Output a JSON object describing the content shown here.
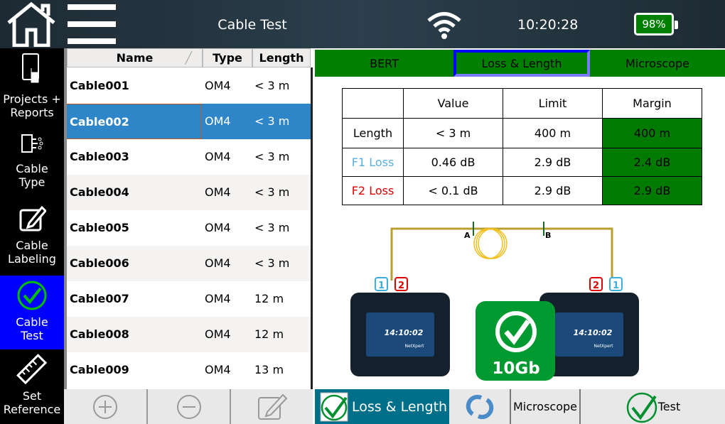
{
  "header": {
    "title": "Cable Test",
    "time": "10:20:28",
    "battery": "98%",
    "icons": [
      "home-icon",
      "menu-icon",
      "wifi-icon",
      "battery-icon"
    ]
  },
  "sidebar": {
    "items": [
      {
        "label1": "Projects +",
        "label2": "Reports",
        "icon": "tablet-touch-icon"
      },
      {
        "label1": "Cable",
        "label2": "Type",
        "icon": "fiber-connector-icon"
      },
      {
        "label1": "Cable",
        "label2": "Labeling",
        "icon": "edit-icon"
      },
      {
        "label1": "Cable",
        "label2": "Test",
        "icon": "check-circle-icon",
        "active": true
      },
      {
        "label1": "Set",
        "label2": "Reference",
        "icon": "ruler-icon"
      }
    ]
  },
  "cable_list": {
    "columns": [
      "Name",
      "Type",
      "Length"
    ],
    "selected": "Cable002",
    "rows": [
      {
        "name": "Cable001",
        "type": "OM4",
        "length": "< 3 m"
      },
      {
        "name": "Cable002",
        "type": "OM4",
        "length": "< 3 m"
      },
      {
        "name": "Cable003",
        "type": "OM4",
        "length": "< 3 m"
      },
      {
        "name": "Cable004",
        "type": "OM4",
        "length": "< 3 m"
      },
      {
        "name": "Cable005",
        "type": "OM4",
        "length": "< 3 m"
      },
      {
        "name": "Cable006",
        "type": "OM4",
        "length": "< 3 m"
      },
      {
        "name": "Cable007",
        "type": "OM4",
        "length": "12 m"
      },
      {
        "name": "Cable008",
        "type": "OM4",
        "length": "12 m"
      },
      {
        "name": "Cable009",
        "type": "OM4",
        "length": "13 m"
      }
    ],
    "toolbar": [
      "add-icon",
      "remove-icon",
      "edit-icon"
    ]
  },
  "tabs": [
    {
      "label": "BERT"
    },
    {
      "label": "Loss & Length",
      "active": true
    },
    {
      "label": "Microscope"
    }
  ],
  "results": {
    "columns": [
      "",
      "Value",
      "Limit",
      "Margin"
    ],
    "rows": [
      {
        "label": "Length",
        "value": "< 3 m",
        "limit": "400 m",
        "margin": "400 m",
        "color": "#000000"
      },
      {
        "label": "F1 Loss",
        "value": "0.46 dB",
        "limit": "2.9 dB",
        "margin": "2.4 dB",
        "color": "#5aaee0"
      },
      {
        "label": "F2 Loss",
        "value": "< 0.1 dB",
        "limit": "2.9 dB",
        "margin": "2.9 dB",
        "color": "#e00000"
      }
    ]
  },
  "diagram": {
    "point_a": "A",
    "point_b": "B",
    "left_ports": [
      "1",
      "2"
    ],
    "right_ports": [
      "2",
      "1"
    ],
    "device_time": "14:10:02",
    "brand": "NetXpert",
    "badge": "10Gb"
  },
  "bottom_bar": {
    "loss_length": "Loss & Length",
    "microscope": "Microscope",
    "test": "Test"
  },
  "colors": {
    "pass_green": "#008000",
    "active_blue": "#0000ff",
    "selected_row": "#2e86c8"
  }
}
